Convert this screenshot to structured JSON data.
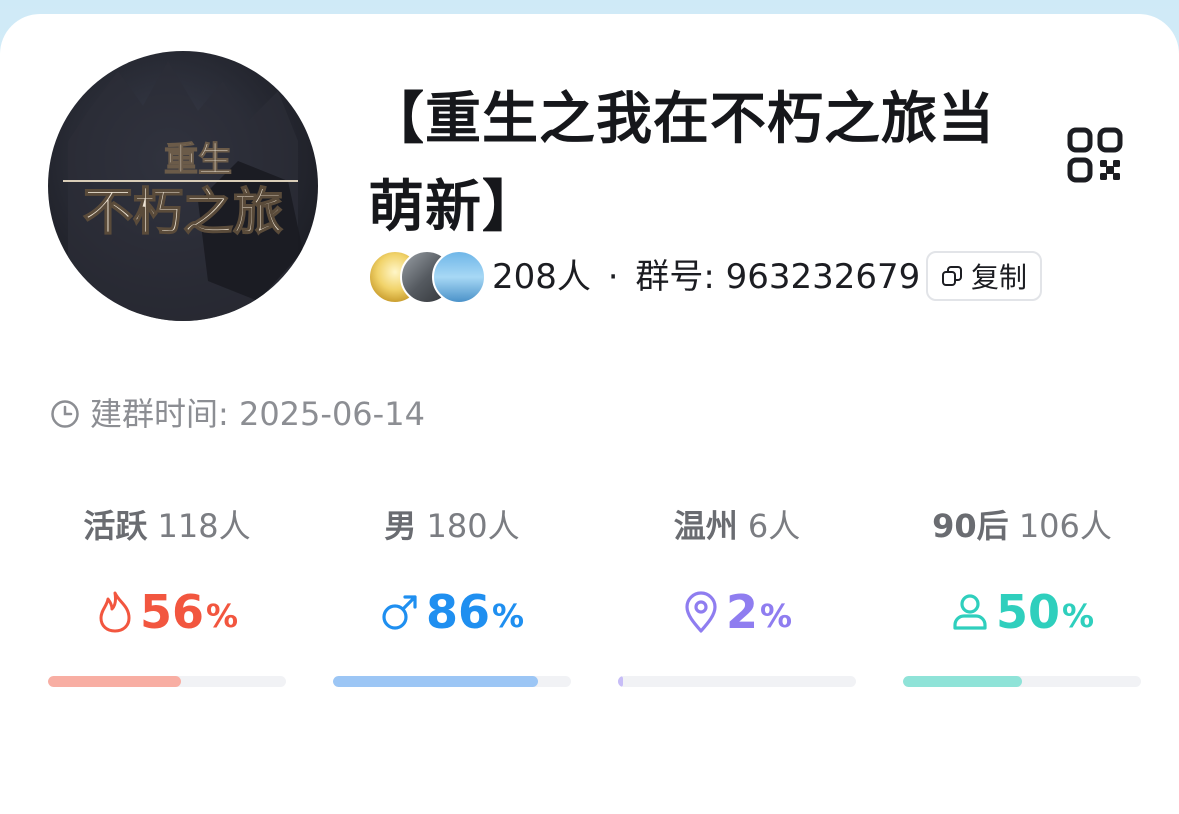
{
  "group": {
    "name": "【重生之我在不朽之旅当萌新】",
    "avatar_text_top": "重生",
    "avatar_text_bottom": "不朽之旅",
    "member_count": "208人",
    "separator": "·",
    "group_number_label": "群号: 963232679",
    "copy_label": "复制",
    "created_label": "建群时间: 2025-06-14"
  },
  "stats": [
    {
      "label": "活跃",
      "count": "118人",
      "percent": "56",
      "percent_sign": "%",
      "fraction": 0.56,
      "color": "#f2563f",
      "track_color": "#f8aea3",
      "icon": "flame-icon"
    },
    {
      "label": "男",
      "count": "180人",
      "percent": "86",
      "percent_sign": "%",
      "fraction": 0.86,
      "color": "#1f8ff0",
      "track_color": "#9cc6f5",
      "icon": "male-icon"
    },
    {
      "label": "温州",
      "count": "6人",
      "percent": "2",
      "percent_sign": "%",
      "fraction": 0.02,
      "color": "#8f7df0",
      "track_color": "#c7bdf7",
      "icon": "location-pin-icon"
    },
    {
      "label": "90后",
      "count": "106人",
      "percent": "50",
      "percent_sign": "%",
      "fraction": 0.5,
      "color": "#2fcfbd",
      "track_color": "#8fe3d8",
      "icon": "person-icon"
    }
  ]
}
